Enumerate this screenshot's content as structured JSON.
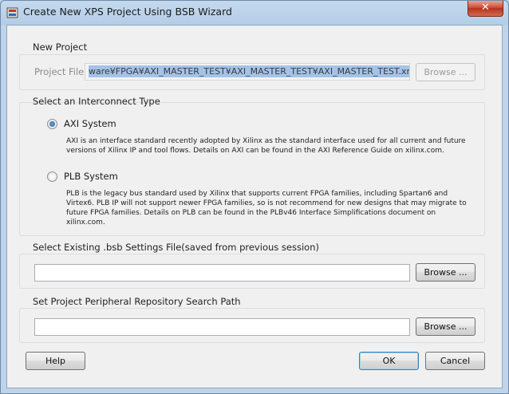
{
  "window": {
    "title": "Create New XPS Project Using BSB Wizard",
    "close_label": "✕"
  },
  "new_project": {
    "group_label": "New Project",
    "project_file_label": "Project File",
    "project_file_value": "ware¥FPGA¥AXI_MASTER_TEST¥AXI_MASTER_TEST¥AXI_MASTER_TEST.xmp",
    "browse_label": "Browse ..."
  },
  "interconnect": {
    "group_label": "Select an Interconnect Type",
    "axi_label": "AXI System",
    "axi_desc": "AXI is an interface standard recently adopted by Xilinx as the standard interface used for all current and future versions of Xilinx IP and tool flows.  Details on AXI can be found in the AXI Reference Guide on xilinx.com.",
    "plb_label": "PLB System",
    "plb_desc": "PLB is the legacy bus standard used by Xilinx that supports current FPGA families, including Spartan6 and Virtex6.  PLB IP will not support newer FPGA families, so is not recommend for new designs that may migrate to future FPGA families.  Details on PLB can be found in the PLBv46 Interface Simplifications document on xilinx.com.",
    "selected": "AXI System"
  },
  "bsb_settings": {
    "group_label": "Select Existing .bsb Settings File(saved from previous session)",
    "value": "",
    "browse_label": "Browse ..."
  },
  "repository": {
    "group_label": "Set Project Peripheral Repository Search Path",
    "value": "",
    "browse_label": "Browse ..."
  },
  "footer": {
    "help_label": "Help",
    "ok_label": "OK",
    "cancel_label": "Cancel"
  }
}
